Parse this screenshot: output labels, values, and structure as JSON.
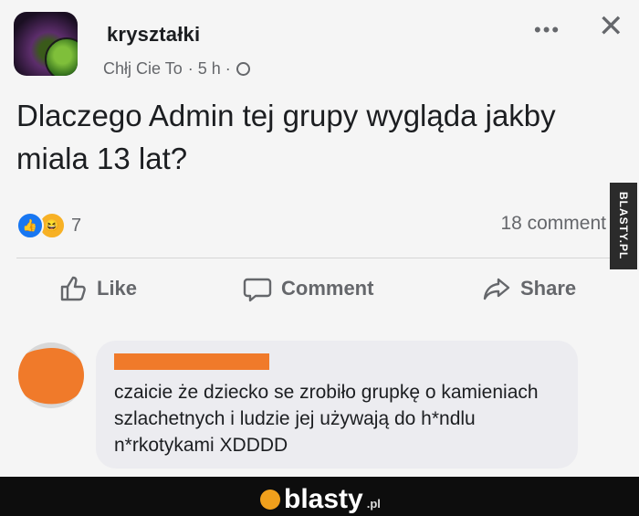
{
  "post": {
    "author": "kryształki",
    "meta_group": "Chłj Cie To",
    "meta_time": "· 5 h ·",
    "more_icon": "•••",
    "close_icon": "✕",
    "text": "Dlaczego Admin tej grupy wygląda jakby miala 13 lat?",
    "reaction_count": "7",
    "comments_count": "18 comment",
    "actions": {
      "like": "Like",
      "comment": "Comment",
      "share": "Share"
    }
  },
  "comment": {
    "text": "czaicie że dziecko se zrobiło grupkę o kamieniach szlachetnych i ludzie jej używają do h*ndlu n*rkotykami XDDDD"
  },
  "watermark": {
    "side": "BLASTY.PL",
    "brand": "blasty",
    "tld": ".pl"
  },
  "colors": {
    "like_blue": "#1877f2",
    "redaction_orange": "#f07a2a",
    "muted_text": "#65676b"
  }
}
